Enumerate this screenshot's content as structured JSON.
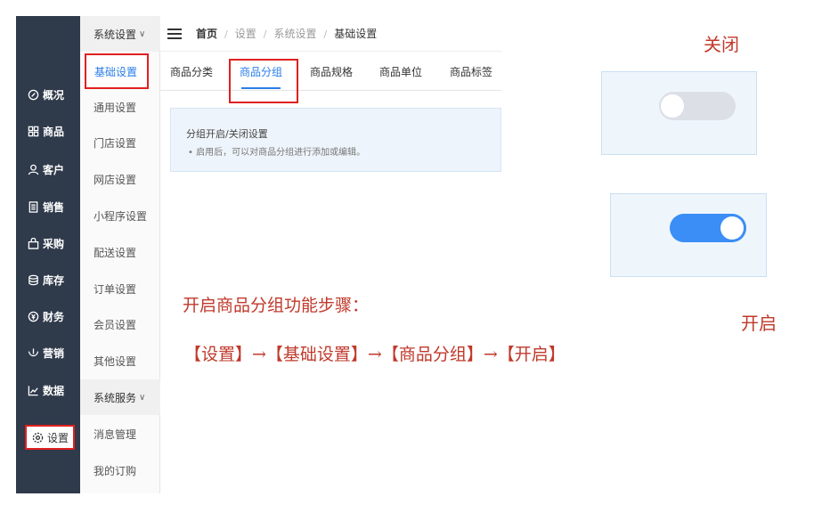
{
  "left_nav": {
    "items": [
      {
        "label": "概况",
        "icon": "overview-icon"
      },
      {
        "label": "商品",
        "icon": "goods-icon"
      },
      {
        "label": "客户",
        "icon": "customer-icon"
      },
      {
        "label": "销售",
        "icon": "sales-icon"
      },
      {
        "label": "采购",
        "icon": "purchase-icon"
      },
      {
        "label": "库存",
        "icon": "stock-icon"
      },
      {
        "label": "财务",
        "icon": "finance-icon"
      },
      {
        "label": "营销",
        "icon": "marketing-icon"
      },
      {
        "label": "数据",
        "icon": "data-icon"
      },
      {
        "label": "设置",
        "icon": "settings-icon",
        "active": true
      }
    ]
  },
  "sub_menu": {
    "group1": "系统设置",
    "items": [
      "基础设置",
      "通用设置",
      "门店设置",
      "网店设置",
      "小程序设置",
      "配送设置",
      "订单设置",
      "会员设置",
      "其他设置"
    ],
    "group2": "系统服务",
    "items2": [
      "消息管理",
      "我的订购"
    ]
  },
  "breadcrumb": [
    "首页",
    "设置",
    "系统设置",
    "基础设置"
  ],
  "tabs": [
    "商品分类",
    "商品分组",
    "商品规格",
    "商品单位",
    "商品标签"
  ],
  "active_tab": "商品分组",
  "panel": {
    "title": "分组开启/关闭设置",
    "note": "启用后，可以对商品分组进行添加或编辑。"
  },
  "annotations": {
    "off_label": "关闭",
    "on_label": "开启",
    "steps_title": "开启商品分组功能步骤：",
    "steps": "【设置】→【基础设置】→【商品分组】→【开启】"
  },
  "colors": {
    "sidebar_bg": "#2f3a4b",
    "accent": "#2a7de8",
    "highlight_border": "#e02020",
    "switch_on": "#3a8ef5",
    "switch_off": "#dcdfe6"
  }
}
